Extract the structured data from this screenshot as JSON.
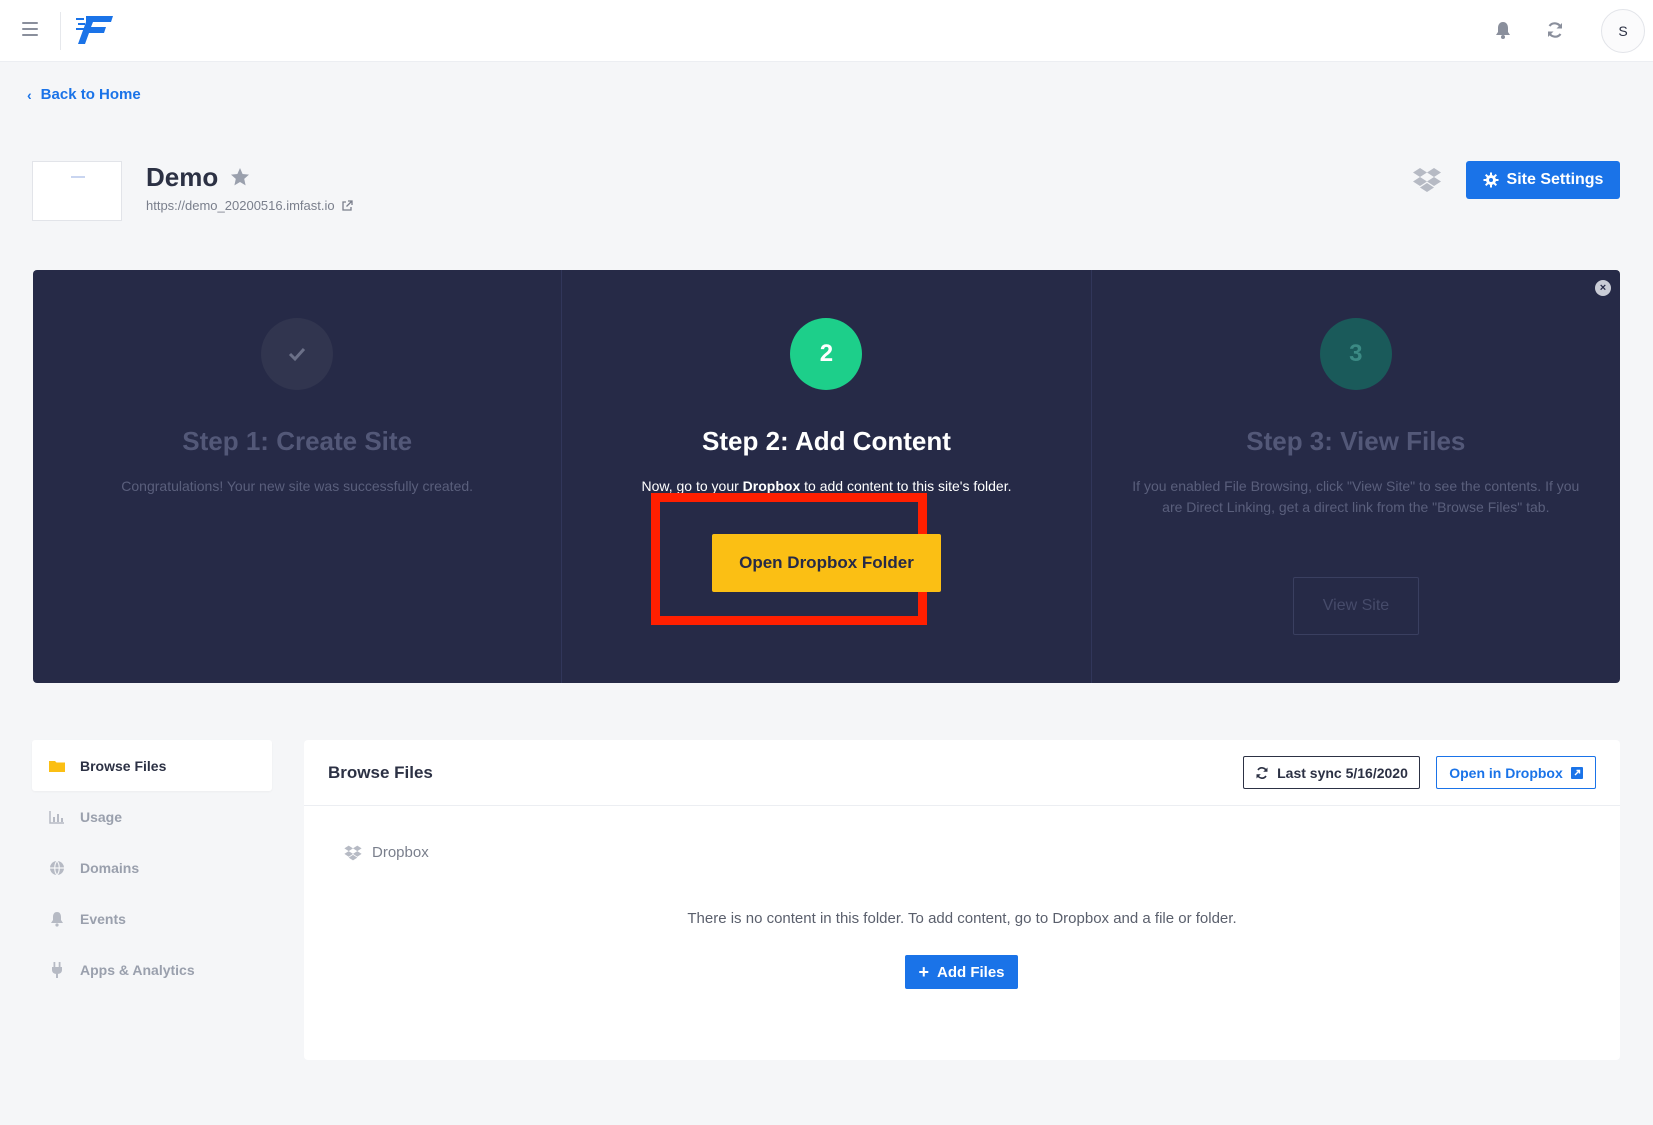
{
  "header": {
    "menu_icon": "hamburger-icon",
    "logo_icon": "imfast-logo-icon",
    "bell_icon": "bell-icon",
    "sync_icon": "refresh-icon",
    "avatar_initial": "S"
  },
  "back_link": {
    "label": "Back to Home"
  },
  "site": {
    "name": "Demo",
    "url": "https://demo_20200516.imfast.io",
    "settings_label": "Site Settings"
  },
  "steps": [
    {
      "marker": "",
      "marker_icon": "check-icon",
      "title": "Step 1: Create Site",
      "text": "Congratulations! Your new site was successfully created.",
      "state": "done"
    },
    {
      "marker": "2",
      "title": "Step 2: Add Content",
      "text_before": "Now, go to your ",
      "text_bold": "Dropbox",
      "text_after": " to add content to this site's folder.",
      "button_label": "Open Dropbox Folder",
      "state": "active"
    },
    {
      "marker": "3",
      "title": "Step 3: View Files",
      "text": "If you enabled File Browsing, click \"View Site\" to see the contents. If you are Direct Linking, get a direct link from the \"Browse Files\" tab.",
      "button_label": "View Site",
      "state": "pending"
    }
  ],
  "close_label": "×",
  "sidebar": {
    "items": [
      {
        "label": "Browse Files",
        "icon": "folder-icon",
        "active": true
      },
      {
        "label": "Usage",
        "icon": "chart-icon",
        "active": false
      },
      {
        "label": "Domains",
        "icon": "globe-icon",
        "active": false
      },
      {
        "label": "Events",
        "icon": "bell-icon",
        "active": false
      },
      {
        "label": "Apps & Analytics",
        "icon": "plug-icon",
        "active": false
      }
    ]
  },
  "browse": {
    "title": "Browse Files",
    "last_sync_label": "Last sync 5/16/2020",
    "open_dropbox_label": "Open in Dropbox",
    "breadcrumb": "Dropbox",
    "empty_text": "There is no content in this folder. To add content, go to Dropbox and a file or folder.",
    "add_files_label": "Add Files",
    "add_files_plus": "+"
  },
  "colors": {
    "accent": "#1a73e8",
    "panel": "#262a47",
    "step_active": "#1dcf8a",
    "cta": "#fbbf14",
    "highlight": "#ff1f00"
  }
}
